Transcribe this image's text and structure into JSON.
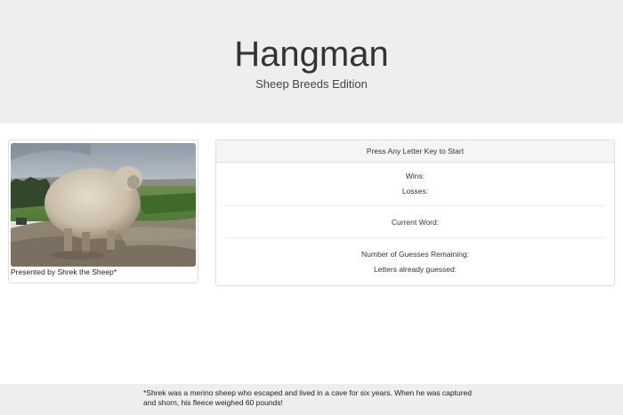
{
  "header": {
    "title": "Hangman",
    "subtitle": "Sheep Breeds Edition"
  },
  "thumbnail": {
    "image": "sheep-photo",
    "caption": "Presented by Shrek the Sheep*"
  },
  "panel": {
    "heading": "Press Any Letter Key to Start",
    "wins_label": "Wins:",
    "losses_label": "Losses:",
    "current_word_label": "Current Word:",
    "guesses_remaining_label": "Number of Guesses Remaining:",
    "letters_guessed_label": "Letters already guessed:"
  },
  "footer": {
    "note_line1": "*Shrek was a merino sheep who escaped and lived in a cave for six years. When he was captured",
    "note_line2": "and shorn, his fleece weighed 60 pounds!"
  },
  "colors": {
    "jumbotron_bg": "#eeeeee",
    "panel_heading_bg": "#f5f5f5",
    "border": "#dddddd"
  }
}
